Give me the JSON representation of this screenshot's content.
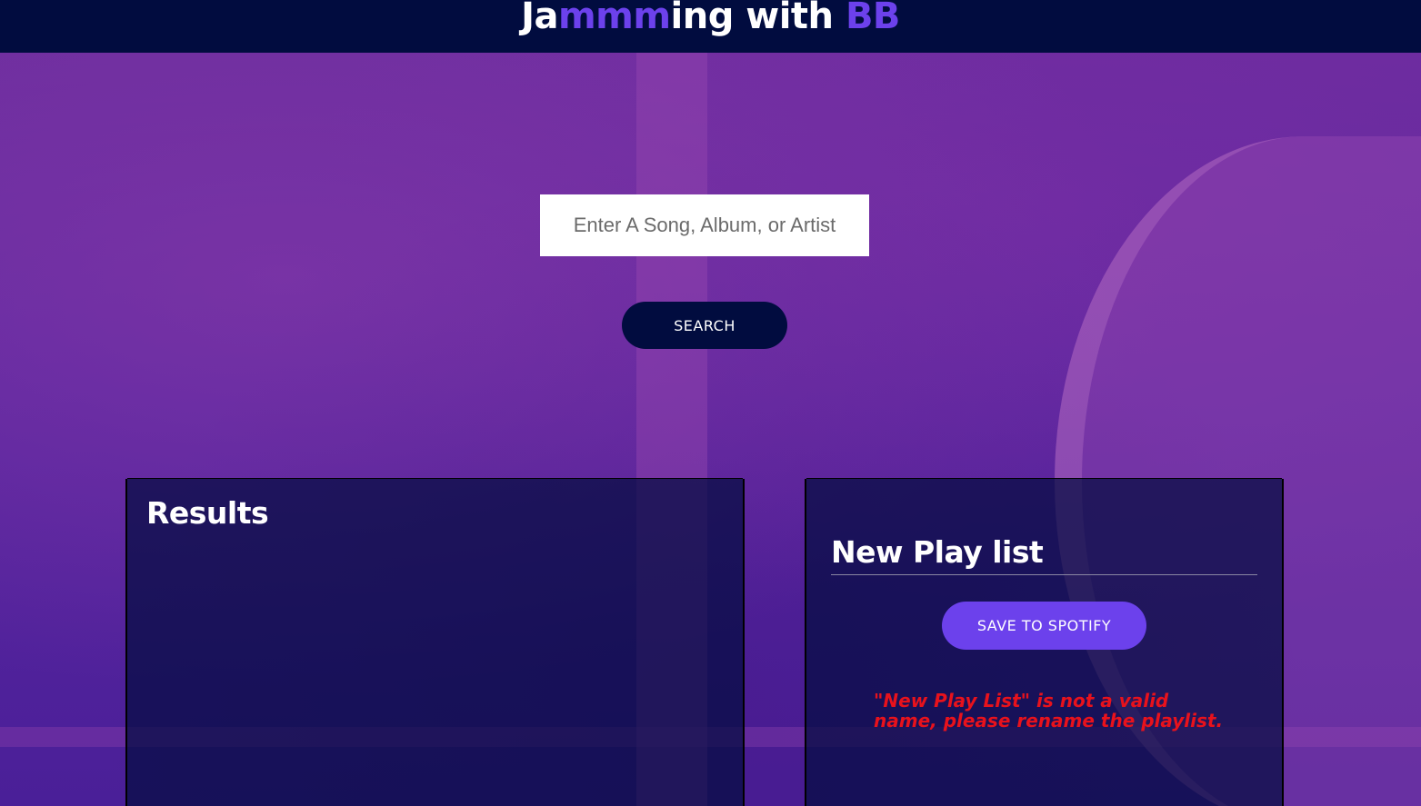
{
  "header": {
    "title_parts": {
      "part1": "Ja",
      "part2": "mmm",
      "part3": "ing with ",
      "part4": "BB"
    }
  },
  "search": {
    "placeholder": "Enter A Song, Album, or Artist",
    "value": "",
    "button_label": "SEARCH"
  },
  "results": {
    "title": "Results",
    "tracks": []
  },
  "playlist": {
    "name": "New Play list",
    "save_label": "SAVE TO SPOTIFY",
    "error_message": "\"New Play List\" is not a valid name, please rename the playlist.",
    "tracks": []
  },
  "colors": {
    "header_bg": "#010c3f",
    "accent": "#6c41ec",
    "error": "#e8121c"
  }
}
